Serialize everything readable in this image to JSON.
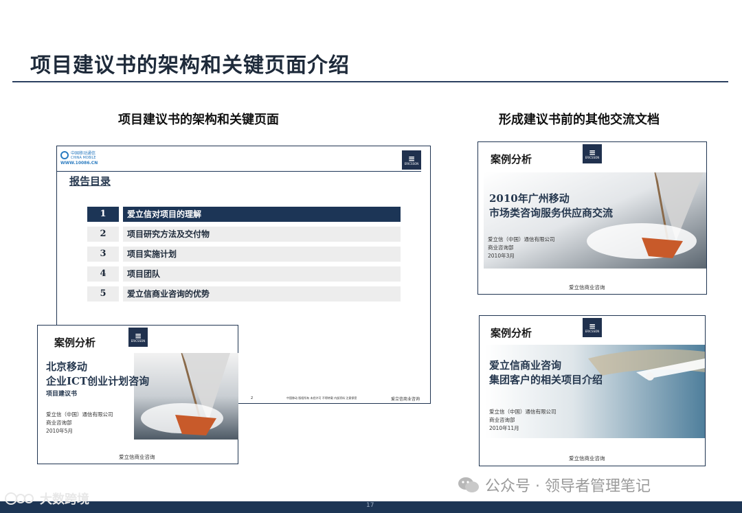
{
  "page": {
    "title": "项目建议书的架构和关键页面介绍",
    "page_number": "17"
  },
  "left": {
    "subtitle": "项目建议书的架构和关键页面",
    "toc_slide": {
      "logo_line1": "中国移动通信",
      "logo_line2": "CHINA MOBILE",
      "logo_url": "WWW.10086.CN",
      "brand_mark": "ERICSSON",
      "heading": "报告目录",
      "items": [
        {
          "num": "1",
          "label": "爱立信对项目的理解"
        },
        {
          "num": "2",
          "label": "项目研究方法及交付物"
        },
        {
          "num": "3",
          "label": "项目实施计划"
        },
        {
          "num": "4",
          "label": "项目团队"
        },
        {
          "num": "5",
          "label": "爱立信商业咨询的优势"
        }
      ],
      "footer_page": "2",
      "footer_note": "中国移动 版权所有 未经许可 不得转载 内部资料 注意保密",
      "footer_brand": "爱立信商业咨询"
    },
    "case_slide": {
      "label": "案例分析",
      "brand_mark": "ERICSSON",
      "title_lines": [
        "北京移动",
        "企业ICT创业计划咨询"
      ],
      "subtitle": "项目建议书",
      "meta": [
        "爱立信（中国）通信有限公司",
        "商业咨询部",
        "2010年5月"
      ],
      "footer": "爱立信商业咨询"
    }
  },
  "right": {
    "subtitle": "形成建议书前的其他交流文档",
    "case1": {
      "label": "案例分析",
      "brand_mark": "ERICSSON",
      "title_lines": [
        "2010年广州移动",
        "市场类咨询服务供应商交流"
      ],
      "meta": [
        "爱立信（中国）通信有限公司",
        "商业咨询部",
        "2010年3月"
      ],
      "footer": "爱立信商业咨询"
    },
    "case2": {
      "label": "案例分析",
      "brand_mark": "ERICSSON",
      "title_lines": [
        "爱立信商业咨询",
        "集团客户的相关项目介绍"
      ],
      "meta": [
        "爱立信（中国）通信有限公司",
        "商业咨询部",
        "2010年11月"
      ],
      "footer": "爱立信商业咨询"
    }
  },
  "watermarks": {
    "wechat": "公众号 · 领导者管理笔记",
    "bottom_left": "大数跨境"
  },
  "colors": {
    "navy": "#1c3556",
    "rule": "#2a3f5f",
    "row_bg": "#ededed"
  }
}
